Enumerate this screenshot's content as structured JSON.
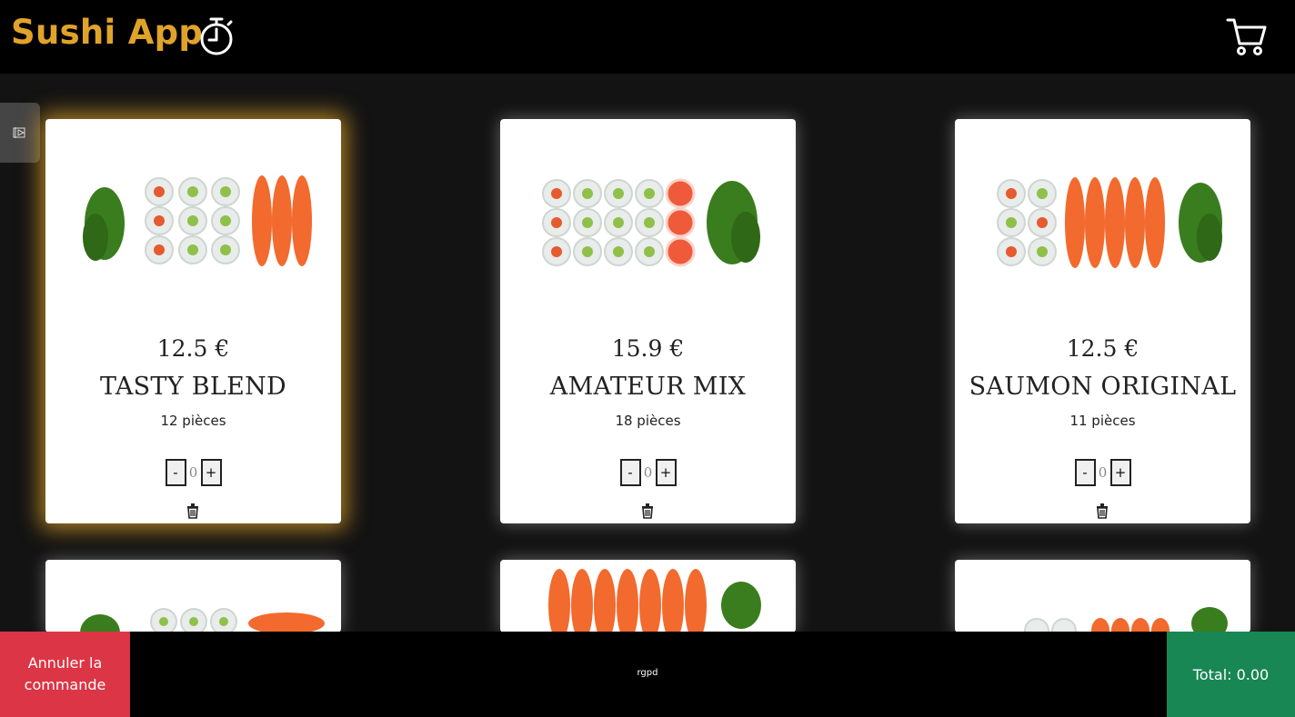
{
  "header": {
    "title": "Sushi App",
    "timer_icon": "timer-icon",
    "cart_icon": "cart-icon"
  },
  "side_tab": {
    "icon": "accessibility-icon"
  },
  "cards": [
    {
      "price": "12.5 €",
      "name": "TASTY BLEND",
      "pieces": "12 pièces",
      "qty": "0",
      "minus": "-",
      "plus": "+"
    },
    {
      "price": "15.9 €",
      "name": "AMATEUR MIX",
      "pieces": "18 pièces",
      "qty": "0",
      "minus": "-",
      "plus": "+"
    },
    {
      "price": "12.5 €",
      "name": "SAUMON ORIGINAL",
      "pieces": "11 pièces",
      "qty": "0",
      "minus": "-",
      "plus": "+"
    }
  ],
  "footer": {
    "cancel_label": "Annuler la commande",
    "rgpd_label": "rgpd",
    "total_label": "Total: 0.00"
  },
  "colors": {
    "brand": "#e0a32a",
    "cancel": "#dc3545",
    "total": "#198754"
  }
}
